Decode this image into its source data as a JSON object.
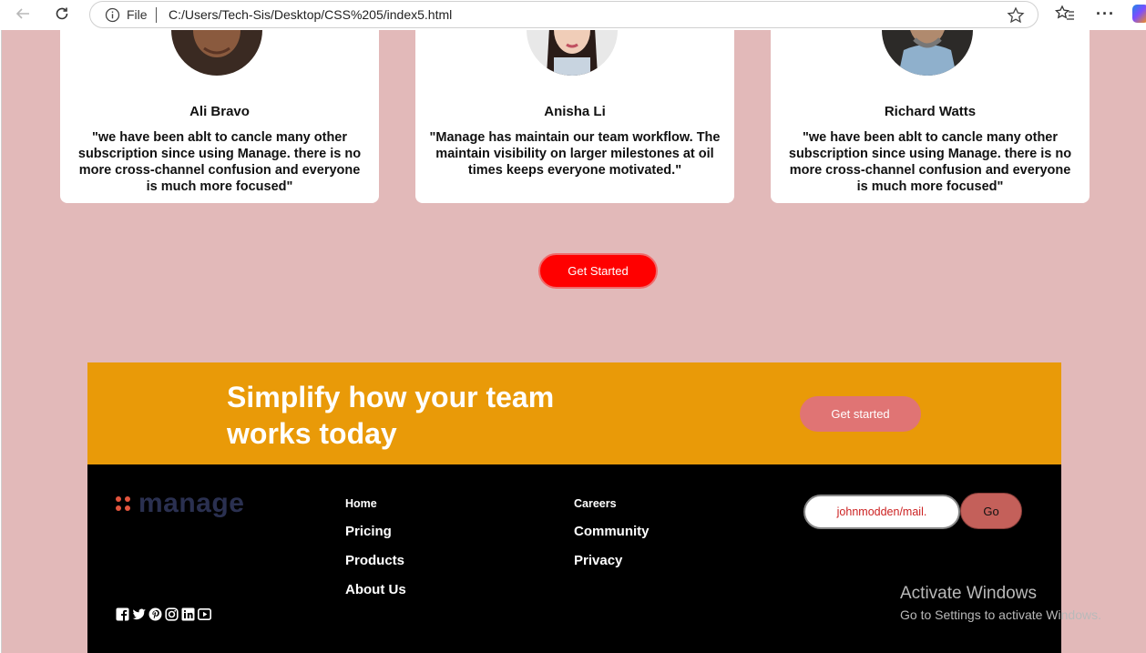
{
  "browser": {
    "file_label": "File",
    "url": "C:/Users/Tech-Sis/Desktop/CSS%205/index5.html"
  },
  "testimonials": [
    {
      "name": "Ali Bravo",
      "quote": "\"we have been ablt to cancle many other subscription since using Manage. there is no more cross-channel confusion and everyone is much more focused\""
    },
    {
      "name": "Anisha Li",
      "quote": "\"Manage has maintain our team workflow. The maintain visibility on larger milestones at oil times keeps everyone motivated.\""
    },
    {
      "name": "Richard Watts",
      "quote": "\"we have been ablt to cancle many other subscription since using Manage. there is no more cross-channel confusion and everyone is much more focused\""
    }
  ],
  "main_cta": {
    "label": "Get Started"
  },
  "cta_band": {
    "title": "Simplify how your team works today",
    "button": "Get started"
  },
  "footer": {
    "logo": "manage",
    "col1": [
      "Home",
      "Pricing",
      "Products",
      "About Us"
    ],
    "col2": [
      "Careers",
      "Community",
      "Privacy"
    ],
    "email_value": "johnmodden/mail.",
    "go_label": "Go",
    "social_icons": [
      "facebook-icon",
      "twitter-icon",
      "pinterest-icon",
      "instagram-icon",
      "linkedin-icon",
      "youtube-icon"
    ]
  },
  "watermark": {
    "line1": "Activate Windows",
    "line2": "Go to Settings to activate Windows."
  },
  "colors": {
    "page_bg": "#e2b9b9",
    "cta_band": "#e99a08",
    "primary_button": "#ff0000",
    "cta_button": "#e07474",
    "footer": "#000000",
    "logo_dots": "#e2553e",
    "logo_text": "#2a3050"
  }
}
